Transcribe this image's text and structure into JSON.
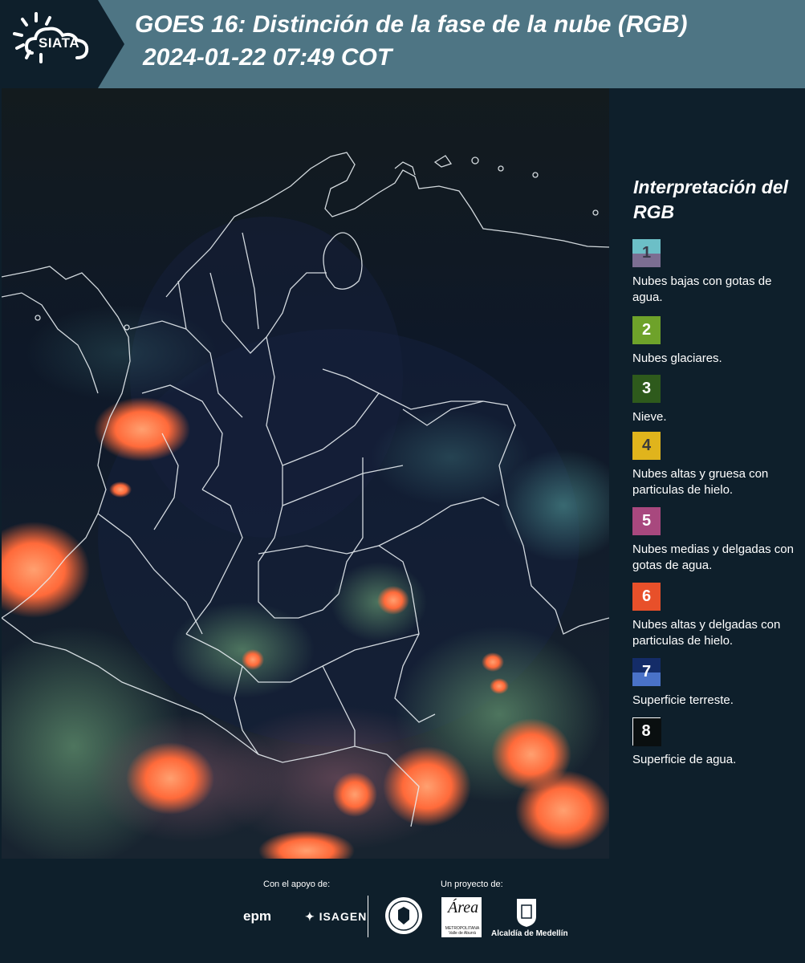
{
  "header": {
    "logo": "SIATA",
    "title_line1": "GOES 16: Distinción de la fase de la nube (RGB)",
    "title_line2": "2024-01-22 07:49 COT",
    "background_color": "#4e7584"
  },
  "legend": {
    "title": "Interpretación del RGB",
    "items": [
      {
        "number": "1",
        "label": "Nubes bajas con gotas de agua.",
        "color_top": "#6cbfc7",
        "color_bottom": "#7c6e92"
      },
      {
        "number": "2",
        "label": "Nubes glaciares.",
        "color_top": "#6ea22a",
        "color_bottom": "#6ea22a"
      },
      {
        "number": "3",
        "label": "Nieve.",
        "color_top": "#2e5a1c",
        "color_bottom": "#2e5a1c"
      },
      {
        "number": "4",
        "label": "Nubes altas y gruesa con particulas de hielo.",
        "color_top": "#e0b41c",
        "color_bottom": "#e0b41c"
      },
      {
        "number": "5",
        "label": "Nubes medias y delgadas con gotas de agua.",
        "color_top": "#a8487e",
        "color_bottom": "#a8487e"
      },
      {
        "number": "6",
        "label": "Nubes altas y delgadas con particulas de hielo.",
        "color_top": "#e8502a",
        "color_bottom": "#e8502a"
      },
      {
        "number": "7",
        "label": "Superficie terreste.",
        "color_top": "#142c68",
        "color_bottom": "#4a72c8"
      },
      {
        "number": "8",
        "label": "Superficie de agua.",
        "color_top": "#0a0f10",
        "color_bottom": "#0a0f10"
      }
    ]
  },
  "footer": {
    "support_label": "Con el apoyo de:",
    "project_label": "Un proyecto de:",
    "sponsors": [
      "epm",
      "ISAGEN"
    ],
    "area_word": "Área",
    "area_sub": "METROPOLITANA Valle de Aburrá",
    "alcaldia": "Alcaldía de Medellín"
  },
  "map": {
    "icon": "satellite-map"
  }
}
